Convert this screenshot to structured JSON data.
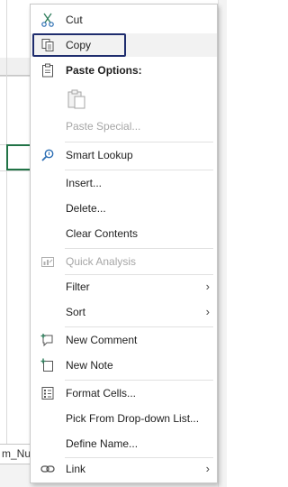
{
  "sheet": {
    "tab_partial_label": "m_Nun"
  },
  "menu": {
    "items": [
      {
        "label": "Cut",
        "icon": "scissors-icon",
        "enabled": true
      },
      {
        "label": "Copy",
        "icon": "copy-icon",
        "enabled": true,
        "highlighted": true
      },
      {
        "label": "Paste Options:",
        "icon": "clipboard-icon",
        "heading": true
      },
      {
        "label": "Paste Special...",
        "enabled": false
      },
      {
        "label": "Smart Lookup",
        "icon": "search-icon",
        "enabled": true
      },
      {
        "label": "Insert...",
        "enabled": true
      },
      {
        "label": "Delete...",
        "enabled": true
      },
      {
        "label": "Clear Contents",
        "enabled": true
      },
      {
        "label": "Quick Analysis",
        "icon": "quick-analysis-icon",
        "enabled": false
      },
      {
        "label": "Filter",
        "enabled": true,
        "submenu": true
      },
      {
        "label": "Sort",
        "enabled": true,
        "submenu": true
      },
      {
        "label": "New Comment",
        "icon": "new-comment-icon",
        "enabled": true
      },
      {
        "label": "New Note",
        "icon": "new-note-icon",
        "enabled": true
      },
      {
        "label": "Format Cells...",
        "icon": "format-cells-icon",
        "enabled": true
      },
      {
        "label": "Pick From Drop-down List...",
        "enabled": true
      },
      {
        "label": "Define Name...",
        "enabled": true
      },
      {
        "label": "Link",
        "icon": "link-icon",
        "enabled": true,
        "submenu": true
      }
    ],
    "submenu_arrow": "›"
  },
  "colors": {
    "focus_border": "#1f2d6e",
    "active_cell": "#217346",
    "disabled_text": "#a6a6a6",
    "icon_green": "#2e7d5b",
    "icon_blue": "#2d6fb4"
  }
}
